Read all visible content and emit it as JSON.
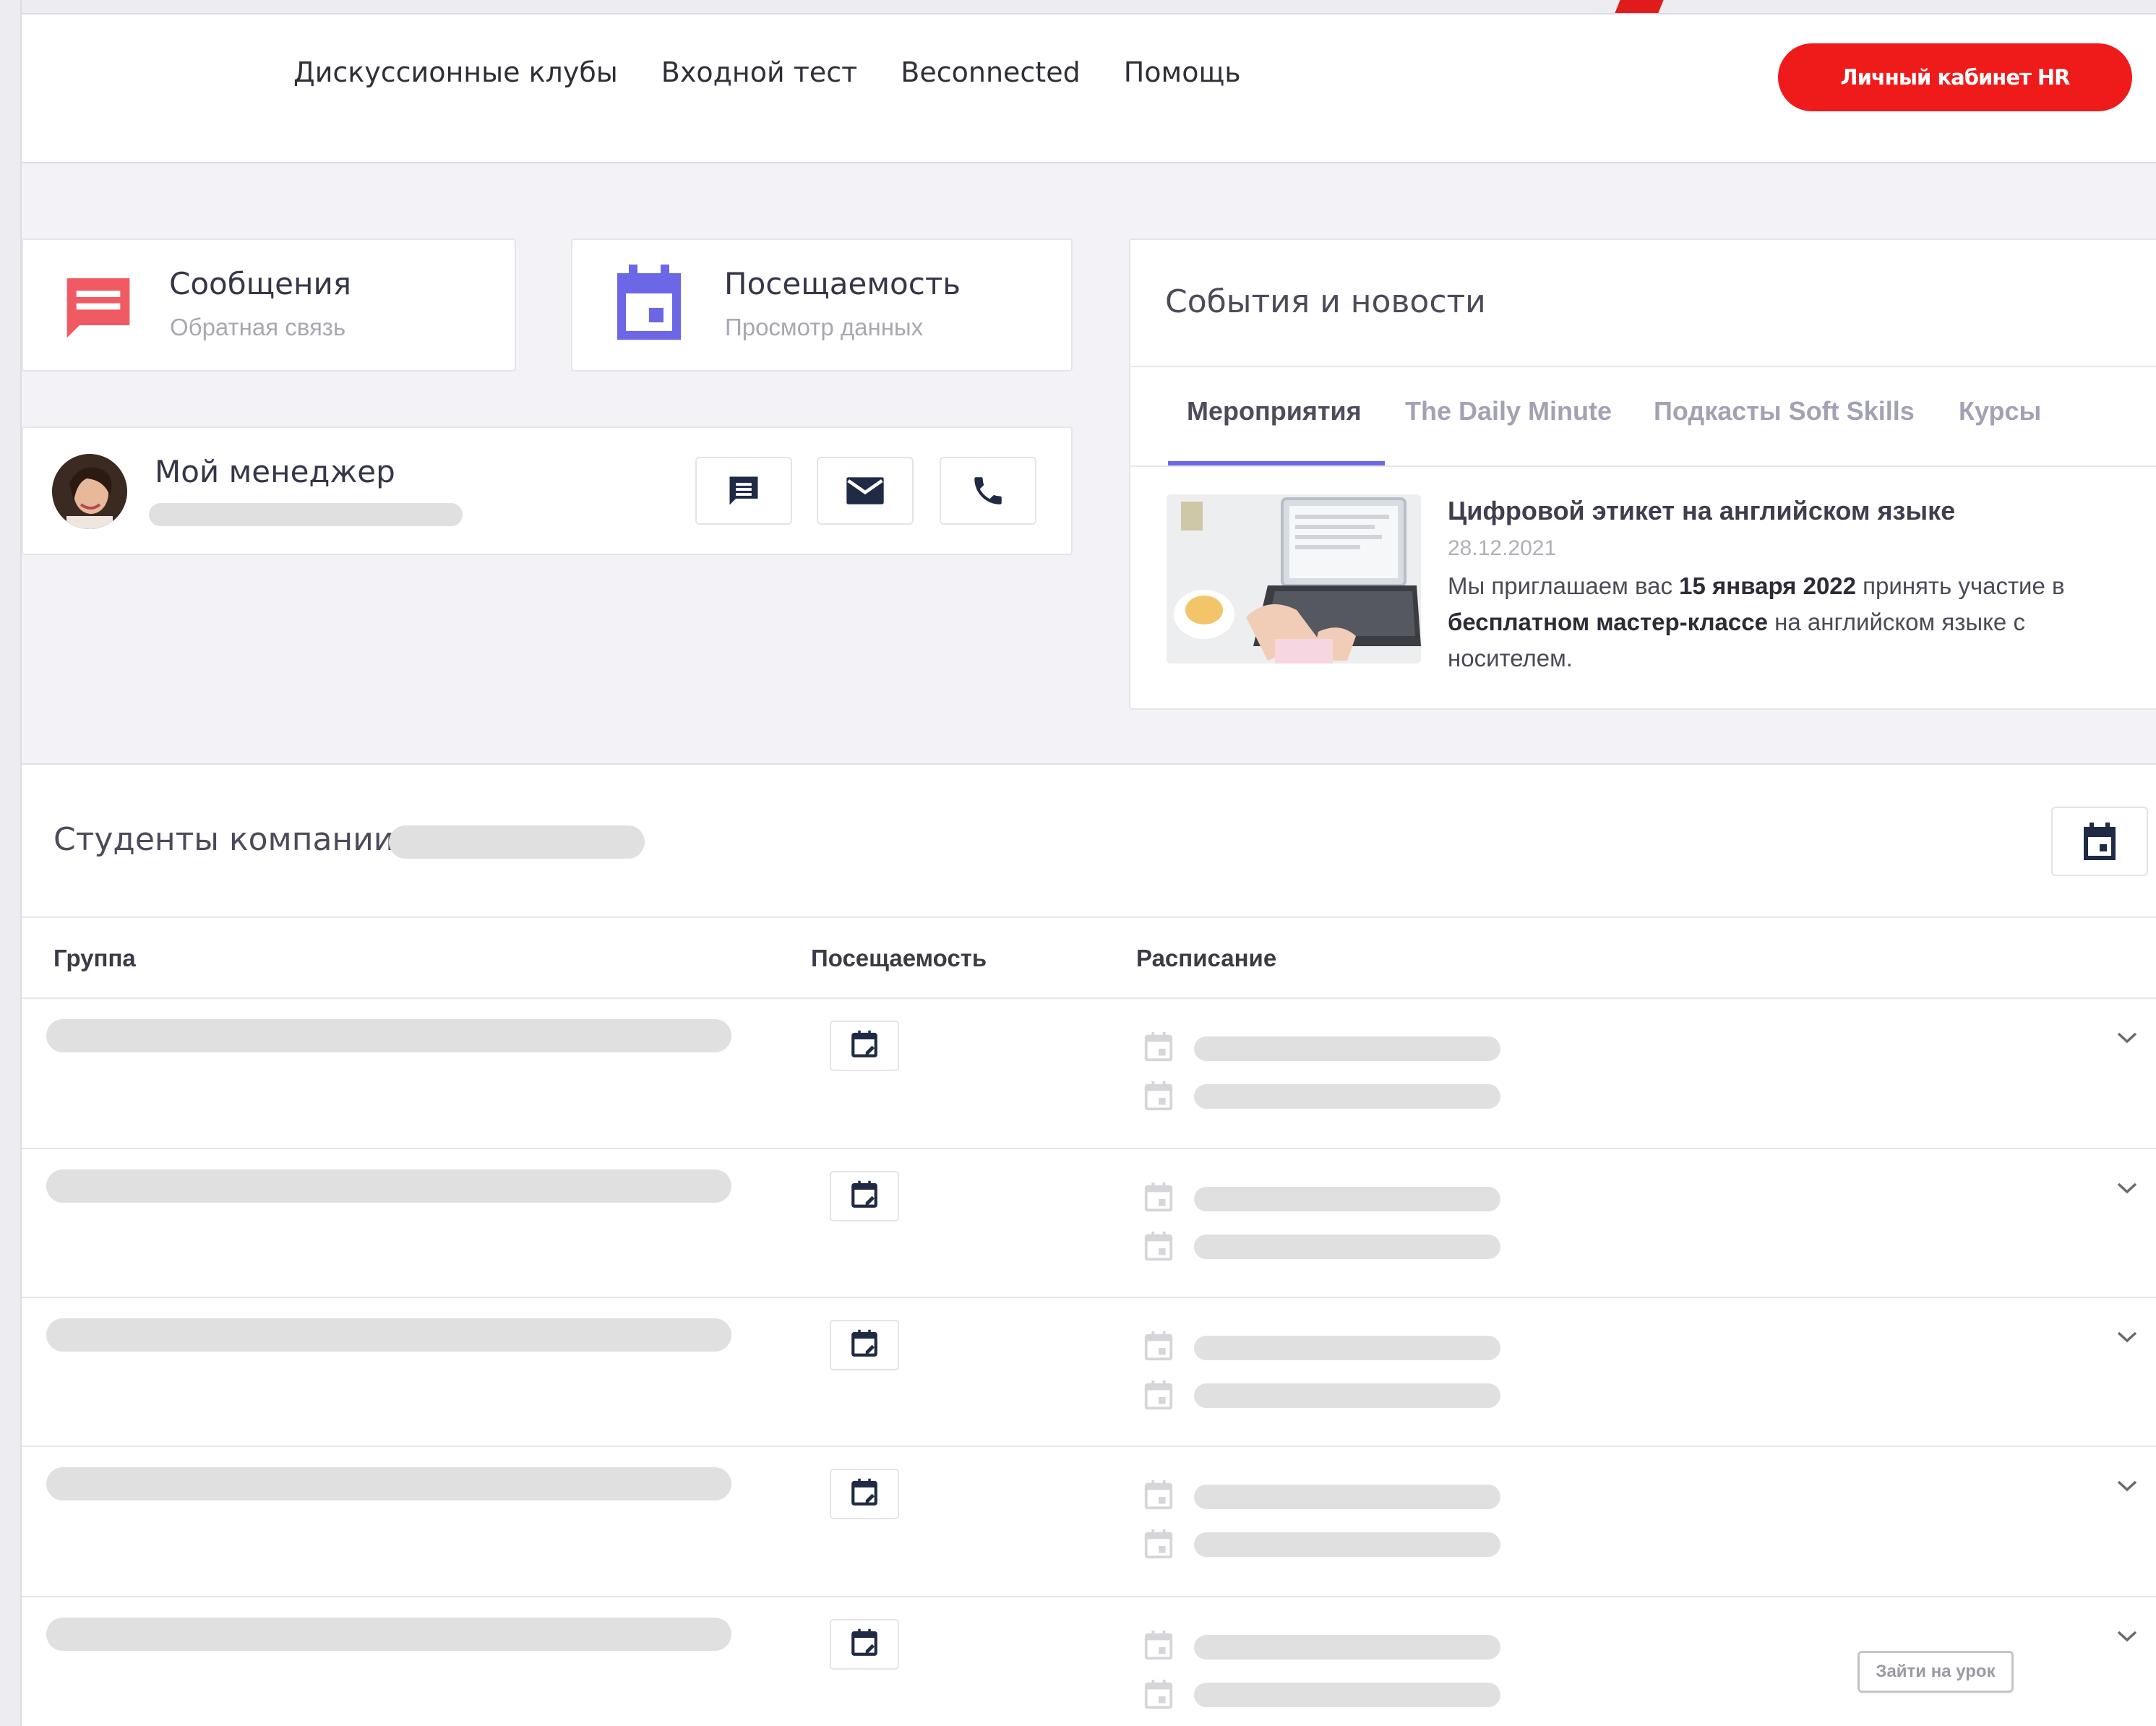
{
  "nav": {
    "items": [
      "Дискуссионные клубы",
      "Входной тест",
      "Beconnected",
      "Помощь"
    ],
    "hr_button": "Личный кабинет HR"
  },
  "cards": {
    "messages": {
      "title": "Сообщения",
      "subtitle": "Обратная связь"
    },
    "attendance": {
      "title": "Посещаемость",
      "subtitle": "Просмотр данных"
    },
    "manager": {
      "title": "Мой менеджер"
    }
  },
  "news": {
    "heading": "События и новости",
    "tabs": [
      "Мероприятия",
      "The Daily Minute",
      "Подкасты Soft Skills",
      "Курсы"
    ],
    "item": {
      "title": "Цифровой этикет на английском языке",
      "date": "28.12.2021",
      "text_1": "Мы приглашаем вас ",
      "text_bold_1": "15 января 2022",
      "text_2": " принять участие в ",
      "text_bold_2": "бесплатном мастер-классе",
      "text_3": " на английском языке с носителем."
    }
  },
  "students": {
    "title": "Студенты компании",
    "columns": [
      "Группа",
      "Посещаемость",
      "Расписание"
    ],
    "join_button": "Зайти на урок"
  },
  "colors": {
    "accent_red": "#ef1a1a",
    "messages_icon": "#f05a63",
    "attendance_icon": "#6b67e6",
    "icon_dark": "#1f2a44"
  }
}
